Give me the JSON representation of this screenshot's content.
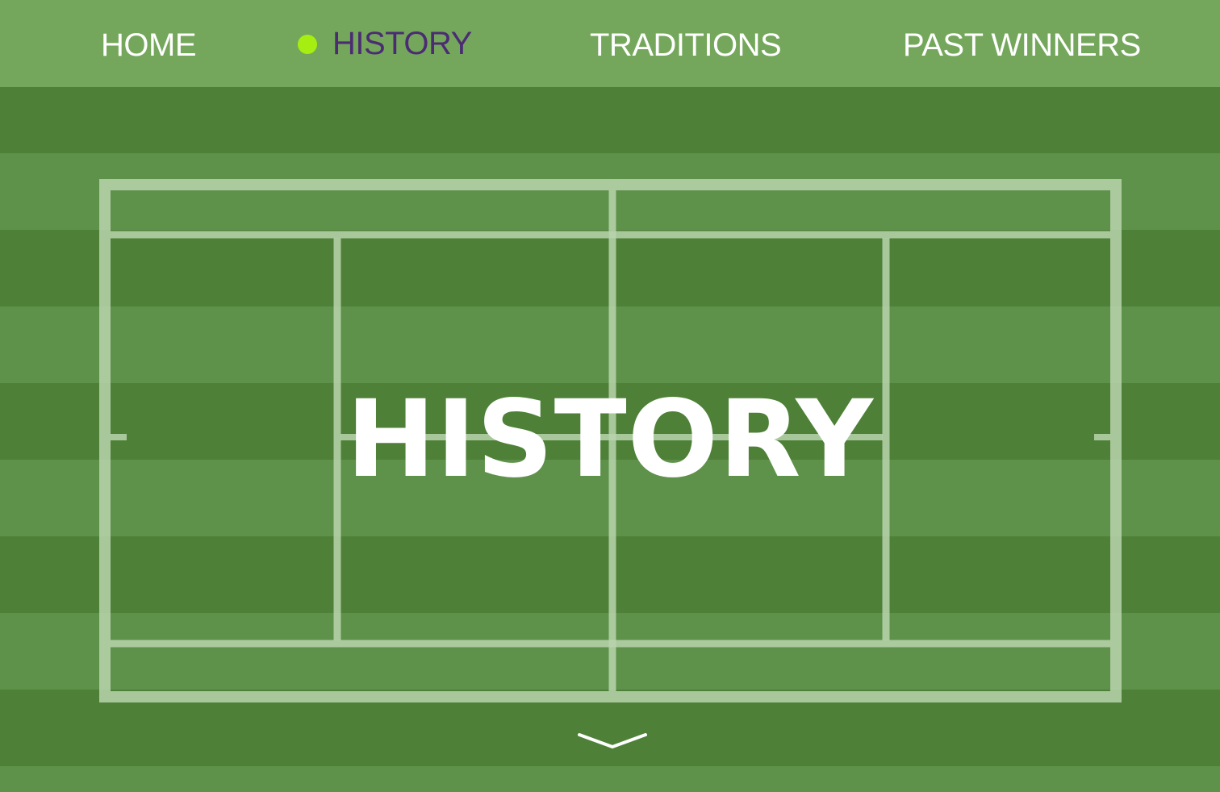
{
  "nav": {
    "items": [
      {
        "label": "HOME",
        "active": false
      },
      {
        "label": "HISTORY",
        "active": true
      },
      {
        "label": "TRADITIONS",
        "active": false
      },
      {
        "label": "PAST WINNERS",
        "active": false
      }
    ]
  },
  "hero": {
    "title": "HISTORY"
  },
  "icons": {
    "active_indicator": "tennis-ball-dot-icon",
    "scroll": "chevron-down-icon"
  },
  "colors": {
    "header_bg": "#74a75b",
    "grass_dark": "#4e8137",
    "grass_light": "#5e9149",
    "active_text": "#4b2c73",
    "active_dot": "#a6ee12",
    "court_line": "#b9d3ad"
  }
}
